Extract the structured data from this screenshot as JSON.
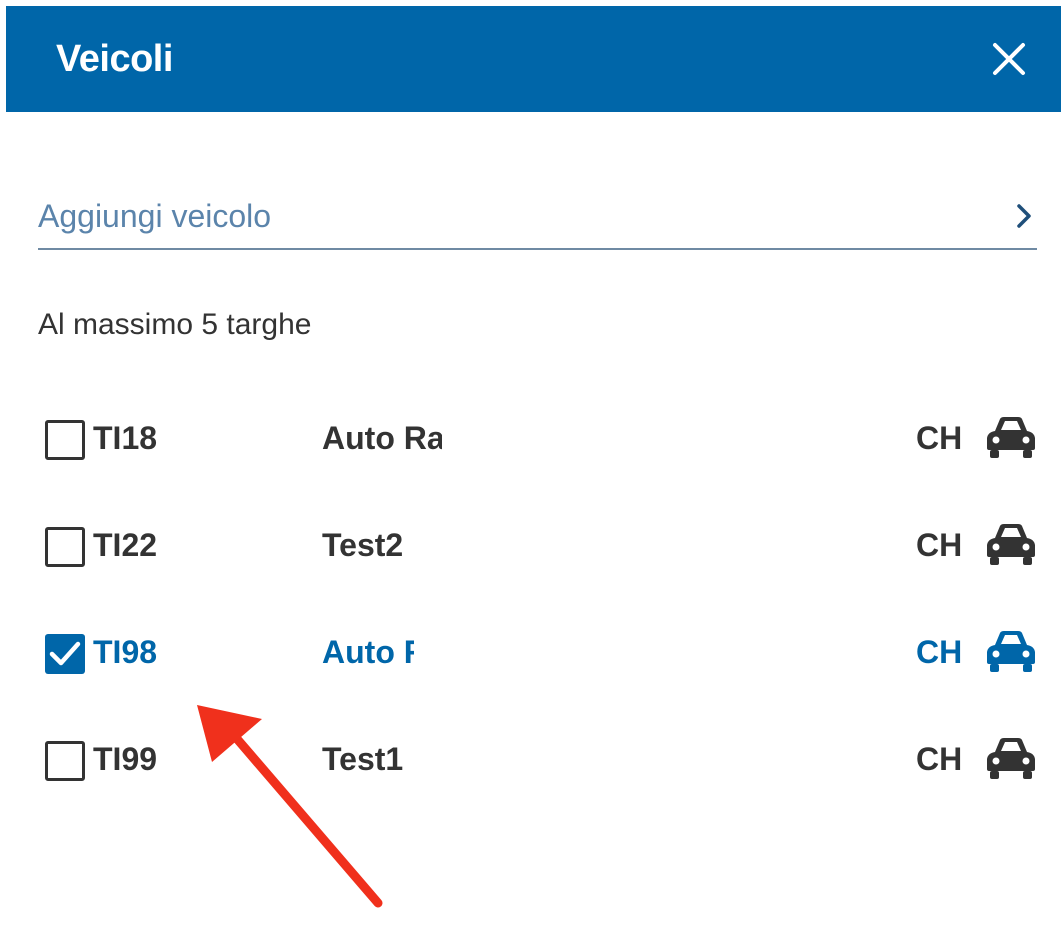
{
  "header": {
    "title": "Veicoli",
    "close_icon": "close-icon",
    "background_color": "#0066a9"
  },
  "add_vehicle": {
    "label": "Aggiungi veicolo",
    "chevron_icon": "chevron-right-icon"
  },
  "limit_text": "Al massimo 5 targhe",
  "vehicles": [
    {
      "plate": "TI18",
      "name": "Auto Ra",
      "country": "CH",
      "icon": "car-icon",
      "checked": false
    },
    {
      "plate": "TI22",
      "name": "Test2",
      "country": "CH",
      "icon": "car-icon",
      "checked": false
    },
    {
      "plate": "TI98",
      "name": "Auto R",
      "country": "CH",
      "icon": "car-icon",
      "checked": true
    },
    {
      "plate": "TI99",
      "name": "Test1",
      "country": "CH",
      "icon": "car-icon",
      "checked": false
    }
  ],
  "colors": {
    "accent": "#0066a9",
    "text": "#333333",
    "link": "#5b84ab",
    "annotation_arrow": "#f0301c"
  }
}
